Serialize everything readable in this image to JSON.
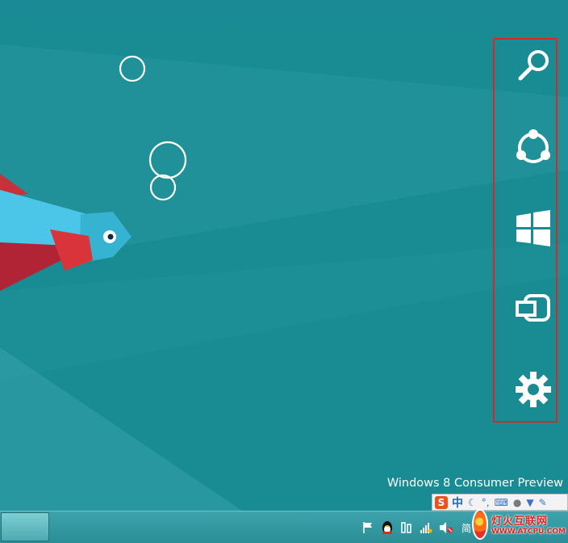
{
  "desktop": {
    "background_color": "#198b93",
    "watermark": "Windows 8 Consumer Preview"
  },
  "charms_bar": {
    "highlight_color": "#d42a2a",
    "items": [
      {
        "name": "Search",
        "icon": "search-icon"
      },
      {
        "name": "Share",
        "icon": "share-icon"
      },
      {
        "name": "Start",
        "icon": "windows-logo-icon"
      },
      {
        "name": "Devices",
        "icon": "devices-icon"
      },
      {
        "name": "Settings",
        "icon": "gear-icon"
      }
    ]
  },
  "ime_toolbar": {
    "logo": "S",
    "mode": "中",
    "icons": [
      "moon-icon",
      "punctuation-icon",
      "keyboard-icon",
      "user-icon",
      "shirt-icon",
      "wrench-icon"
    ]
  },
  "taskbar": {
    "tray_icons": [
      "flag-icon",
      "qq-penguin-icon",
      "network-icon",
      "signal-icon",
      "volume-muted-icon"
    ],
    "clock_partial": "简"
  },
  "site_logo": {
    "cn": "灯火互联网",
    "en": "WWW.ATCPU.COM"
  }
}
